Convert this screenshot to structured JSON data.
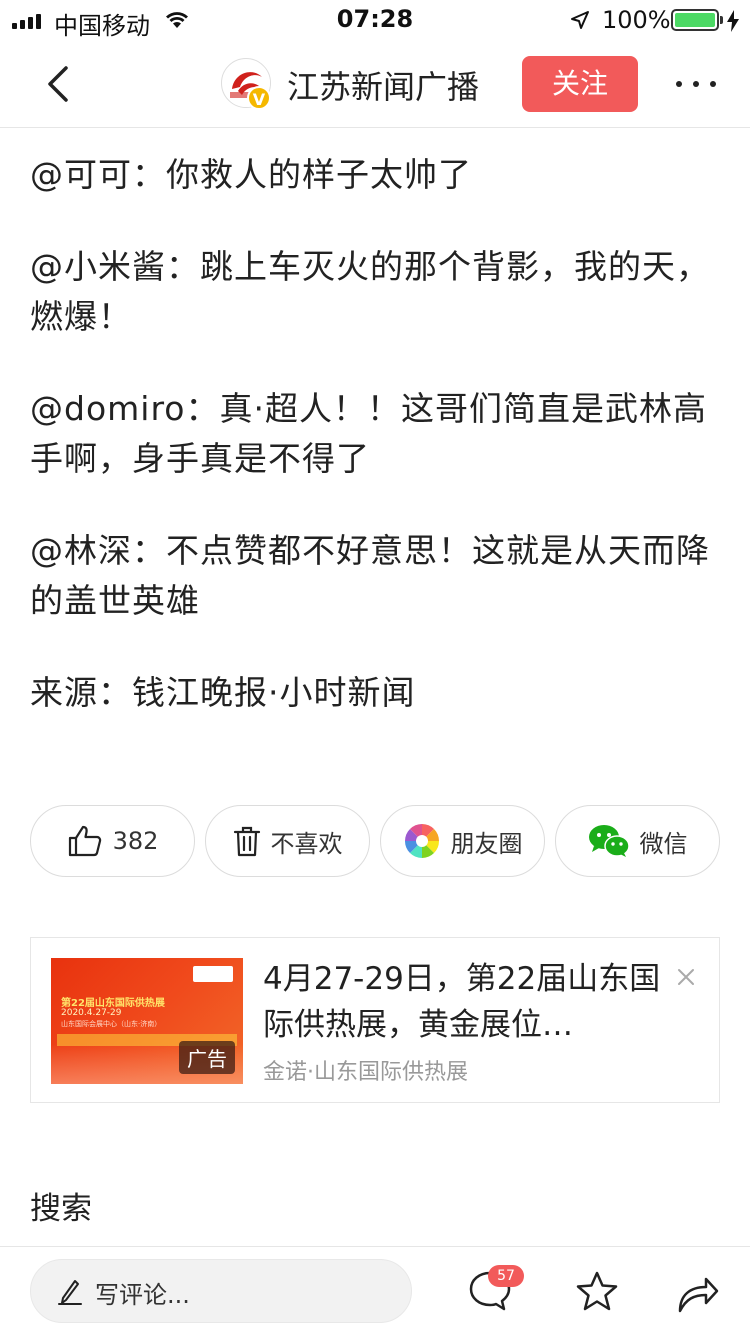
{
  "status_bar": {
    "carrier": "中国移动",
    "time": "07:28",
    "battery": "100%"
  },
  "nav": {
    "title": "江苏新闻广播",
    "follow_label": "关注",
    "verified_badge": "V"
  },
  "article": {
    "paragraphs": [
      "@可可：你救人的样子太帅了",
      "@小米酱：跳上车灭火的那个背影，我的天，燃爆！",
      "@domiro：真·超人！！这哥们简直是武林高手啊，身手真是不得了",
      "@林深：不点赞都不好意思！这就是从天而降的盖世英雄",
      "来源：钱江晚报·小时新闻"
    ]
  },
  "actions": {
    "like_count": "382",
    "dislike_label": "不喜欢",
    "moments_label": "朋友圈",
    "wechat_label": "微信"
  },
  "ad": {
    "title": "4月27-29日，第22届山东国际供热展，黄金展位…",
    "source": "金诺·山东国际供热展",
    "label": "广告",
    "image_title": "第22届山东国际供热展",
    "image_date": "2020.4.27-29",
    "image_venue": "山东国际会展中心（山东·济南）"
  },
  "search": {
    "label": "搜索"
  },
  "bottom_bar": {
    "comment_placeholder": "写评论...",
    "comment_count": "57"
  },
  "colors": {
    "accent": "#f25a5a",
    "battery": "#4cd964",
    "wechat_green": "#1aad19"
  }
}
